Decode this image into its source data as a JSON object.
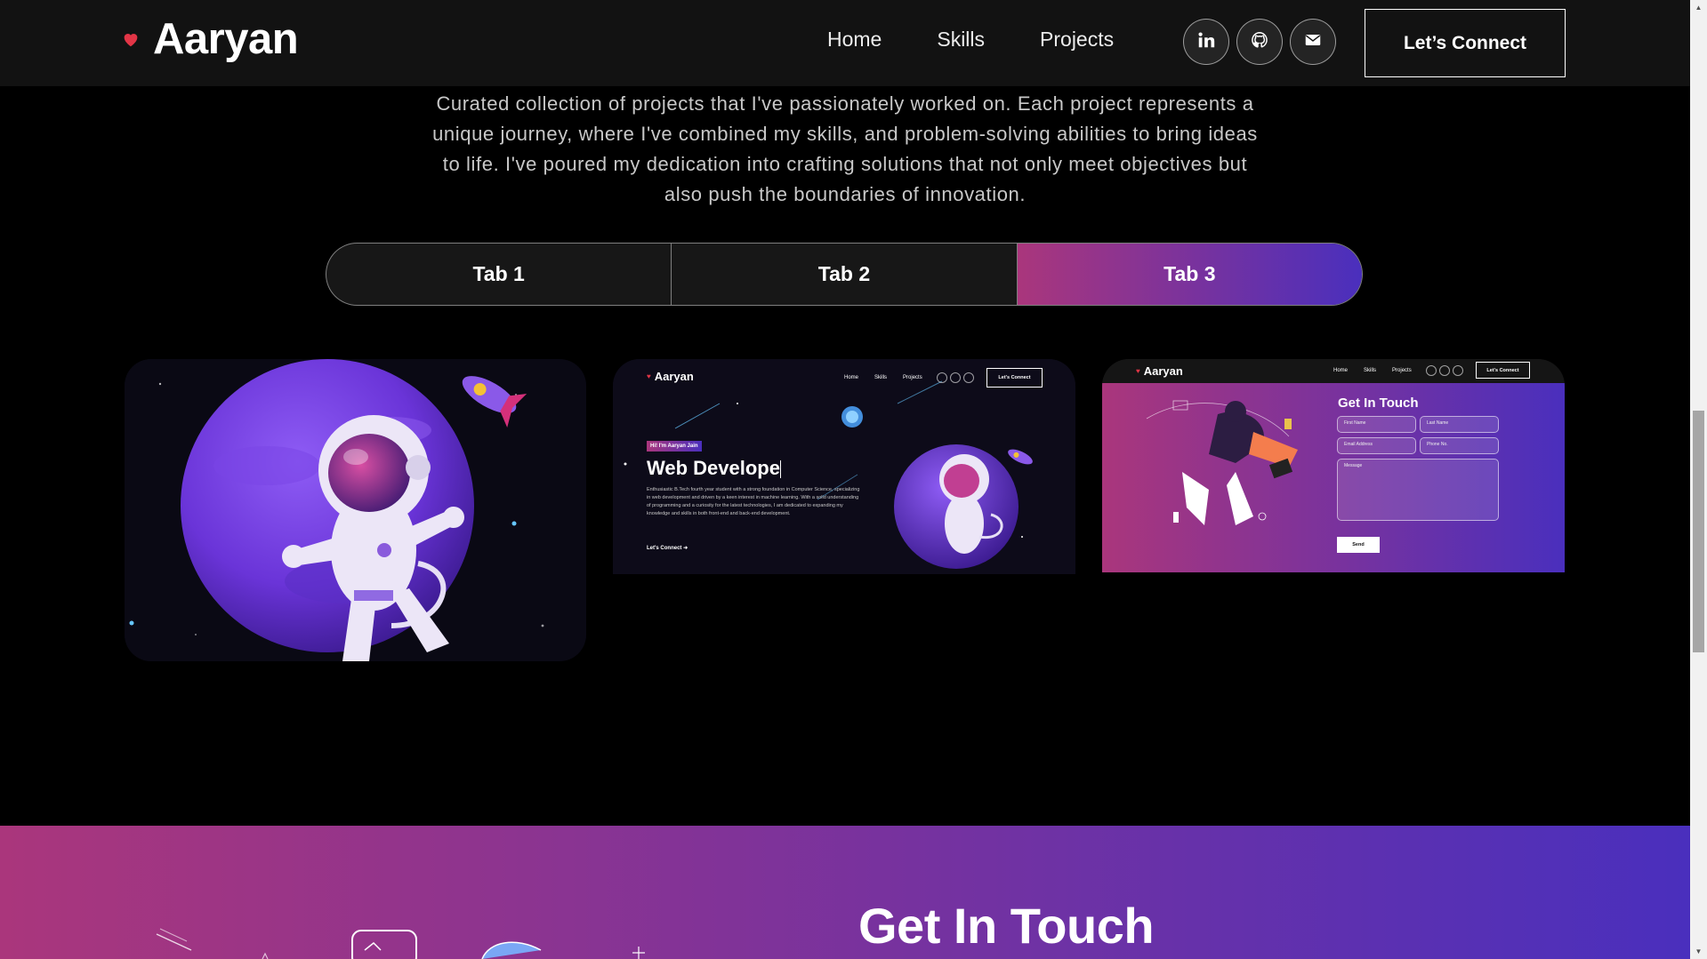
{
  "nav": {
    "brand": "Aaryan",
    "links": [
      "Home",
      "Skills",
      "Projects"
    ],
    "socials": [
      "linkedin-icon",
      "github-icon",
      "mail-icon"
    ],
    "connect_label": "Let’s Connect"
  },
  "projects": {
    "description": "Curated collection of projects that I've passionately worked on. Each project represents a unique journey, where I've combined my skills, and problem-solving abilities to bring ideas to life. I've poured my dedication into crafting solutions that not only meet objectives but also push the boundaries of innovation.",
    "tabs": [
      {
        "label": "Tab 1",
        "active": false
      },
      {
        "label": "Tab 2",
        "active": false
      },
      {
        "label": "Tab 3",
        "active": true
      }
    ],
    "cards": {
      "card2": {
        "brand": "Aaryan",
        "links": [
          "Home",
          "Skills",
          "Projects"
        ],
        "connect": "Let's Connect",
        "tag": "Hi! I'm Aaryan Jain",
        "title": "Web Develope",
        "para": "Enthusiastic B.Tech fourth year student with a strong foundation in Computer Science, specializing in web development and driven by a keen interest in machine learning. With a solid understanding of programming and a curiosity for the latest technologies, I am dedicated to expanding my knowledge and skills in both front-end and back-end development.",
        "cta": "Let's Connect"
      },
      "card3": {
        "brand": "Aaryan",
        "links": [
          "Home",
          "Skills",
          "Projects"
        ],
        "connect": "Let's Connect",
        "title": "Get In Touch",
        "fields": {
          "first_name": "First Name",
          "last_name": "Last Name",
          "email": "Email Address",
          "phone": "Phone No.",
          "message": "Message"
        },
        "send": "Send"
      }
    }
  },
  "contact": {
    "title": "Get In Touch"
  },
  "colors": {
    "accent_start": "#aa367c",
    "accent_end": "#4a2fbd",
    "heart": "#e23546",
    "nav_bg": "#121212"
  }
}
